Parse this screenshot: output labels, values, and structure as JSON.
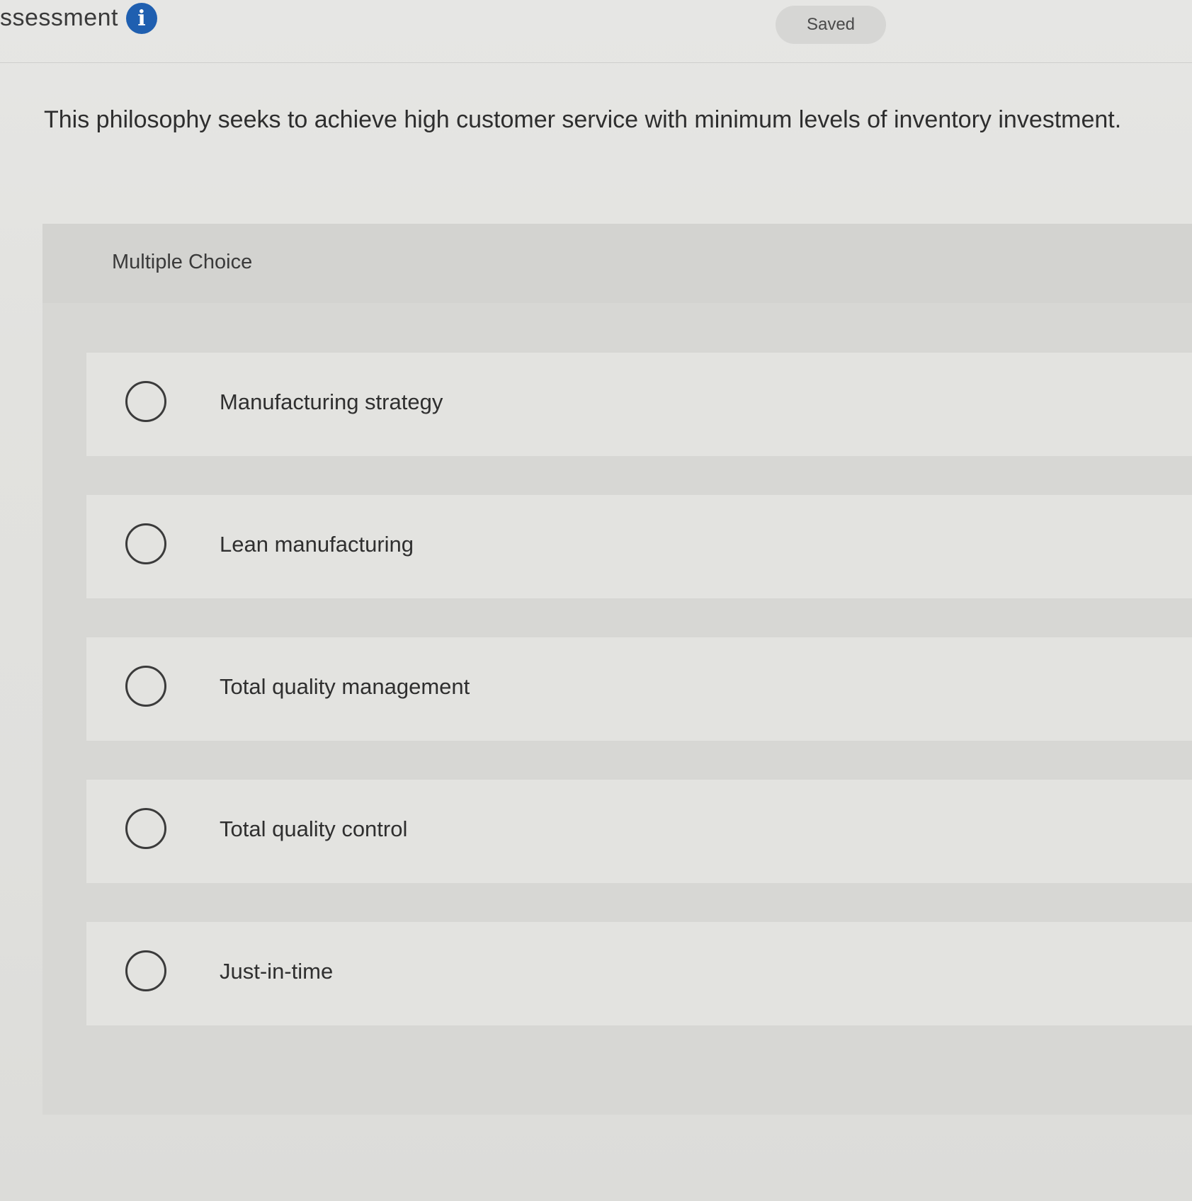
{
  "header": {
    "title": "ssessment",
    "info_icon": "info-icon",
    "status": "Saved"
  },
  "question": {
    "text": "This philosophy seeks to achieve high customer service with minimum levels of inventory investment."
  },
  "multiple_choice": {
    "label": "Multiple Choice",
    "options": [
      {
        "label": "Manufacturing strategy"
      },
      {
        "label": "Lean manufacturing"
      },
      {
        "label": "Total quality management"
      },
      {
        "label": "Total quality control"
      },
      {
        "label": "Just-in-time"
      }
    ]
  },
  "colors": {
    "info_icon_bg": "#1f5fb0",
    "radio_border": "#3b3b3b"
  }
}
